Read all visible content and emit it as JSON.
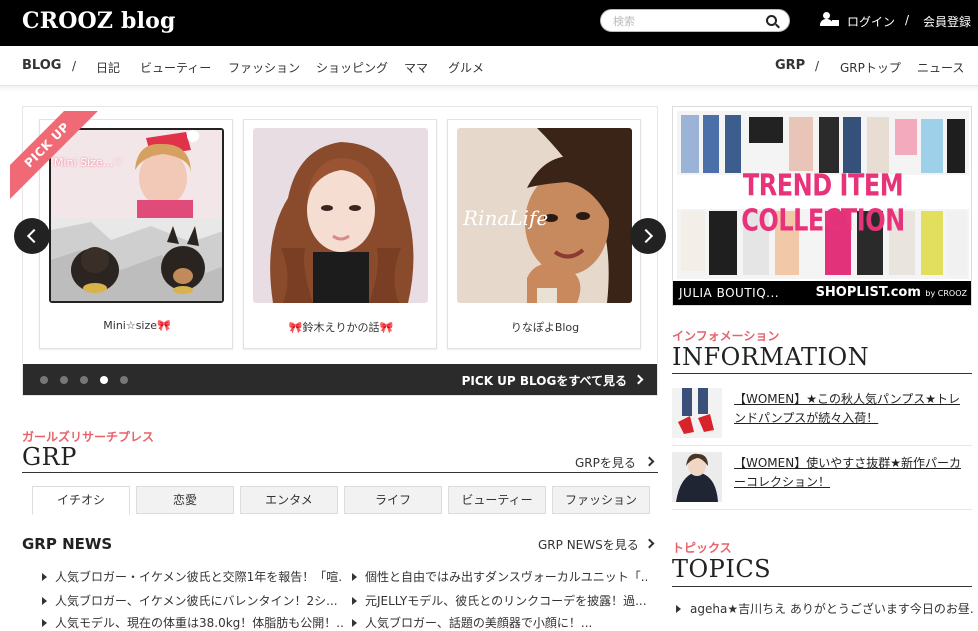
{
  "header": {
    "logo": "CROOZ blog",
    "search_placeholder": "検索",
    "login": "ログイン",
    "separator": "/",
    "register": "会員登録"
  },
  "nav": {
    "left_main": "BLOG",
    "left_items": [
      "日記",
      "ビューティー",
      "ファッション",
      "ショッピング",
      "ママ",
      "グルメ"
    ],
    "right_main": "GRP",
    "right_items": [
      "GRPトップ",
      "ニュース"
    ],
    "separator": "/"
  },
  "pickup": {
    "ribbon": "PICK UP",
    "cards": [
      {
        "name": "Mini☆size🎀",
        "overlay": "Mini Size...♡"
      },
      {
        "name": "🎀鈴木えりかの話🎀",
        "overlay": ""
      },
      {
        "name": "りなぽよBlog",
        "overlay": "RinaLife"
      }
    ],
    "see_all": "PICK UP BLOGをすべて見る",
    "dots_total": 5,
    "active_dot": 4
  },
  "grp": {
    "label": "ガールズリサーチプレス",
    "title": "GRP",
    "more": "GRPを見る",
    "tabs": [
      "イチオシ",
      "恋愛",
      "エンタメ",
      "ライフ",
      "ビューティー",
      "ファッション"
    ],
    "active_tab": 0,
    "news_title": "GRP NEWS",
    "news_more": "GRP NEWSを見る",
    "news_left": [
      "人気ブロガー・イケメン彼氏と交際1年を報告！「喧...",
      "人気ブロガー、イケメン彼氏にバレンタイン！2シ...",
      "人気モデル、現在の体重は38.0kg！体脂肪も公開！..."
    ],
    "news_right": [
      "個性と自由ではみ出すダンスヴォーカルユニット「...",
      "元JELLYモデル、彼氏とのリンクコーデを披露！過...",
      "人気ブロガー、話題の美顔器で小顔に！..."
    ]
  },
  "ad": {
    "title": "TREND ITEM COLLECTION",
    "footer_left": "JULIA BOUTIQ...",
    "footer_right": "SHOPLIST.com",
    "footer_small": "by CROOZ"
  },
  "information": {
    "label": "インフォメーション",
    "title": "INFORMATION",
    "items": [
      "【WOMEN】★この秋人気パンプス★トレンドパンプスが続々入荷！",
      "【WOMEN】使いやすさ抜群★新作パーカーコレクション！"
    ]
  },
  "topics": {
    "label": "トピックス",
    "title": "TOPICS",
    "items": [
      "ageha★吉川ちえ ありがとうございます今日のお昼..."
    ]
  },
  "colors": {
    "accent_pink": "#e8626a",
    "ribbon_pink": "#f06a76",
    "ad_pink": "#e8337a",
    "header_bg": "#000000"
  }
}
